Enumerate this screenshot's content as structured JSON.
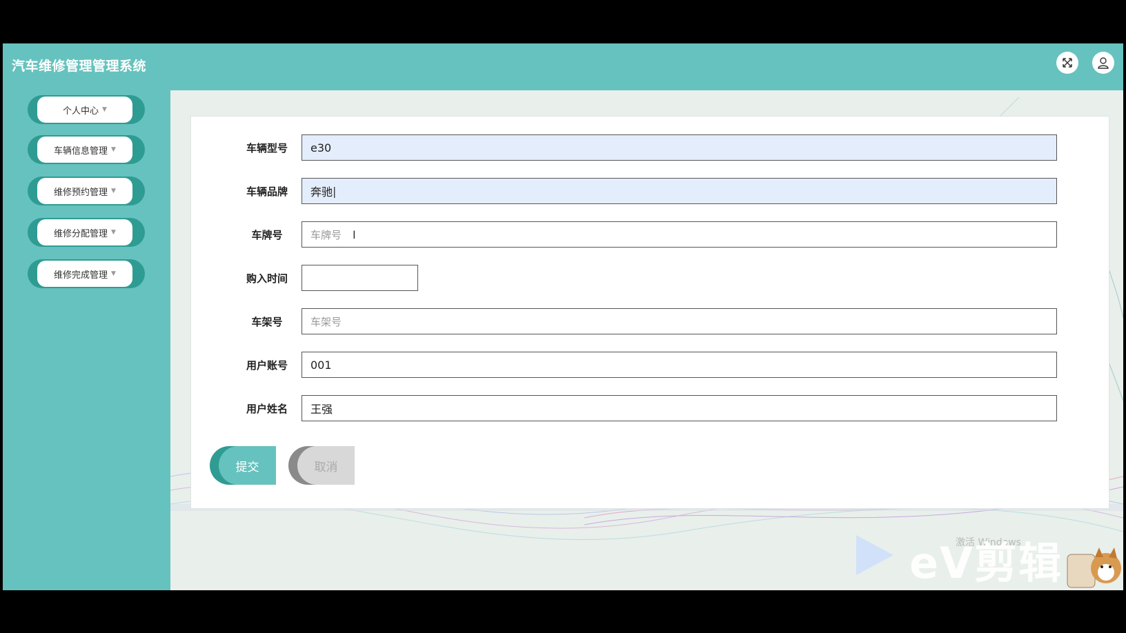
{
  "header": {
    "title": "汽车维修管理管理系统",
    "fullscreen_icon": "fullscreen-icon",
    "user_icon": "user-icon"
  },
  "sidebar": {
    "items": [
      {
        "label": "个人中心"
      },
      {
        "label": "车辆信息管理"
      },
      {
        "label": "维修预约管理"
      },
      {
        "label": "维修分配管理"
      },
      {
        "label": "维修完成管理"
      }
    ]
  },
  "form": {
    "fields": [
      {
        "label": "车辆型号",
        "value": "e30"
      },
      {
        "label": "车辆品牌",
        "value": "奔驰"
      },
      {
        "label": "车牌号",
        "placeholder": "车牌号"
      },
      {
        "label": "购入时间",
        "value": ""
      },
      {
        "label": "车架号",
        "placeholder": "车架号"
      },
      {
        "label": "用户账号",
        "value": "001"
      },
      {
        "label": "用户姓名",
        "value": "王强"
      }
    ],
    "submit_label": "提交",
    "cancel_label": "取消"
  },
  "overlay": {
    "watermark": "eV剪辑",
    "activate_text": "激活 Windows"
  },
  "colors": {
    "accent": "#66c2be",
    "accent_dark": "#2f9c93",
    "input_filled": "#e4edfb"
  }
}
